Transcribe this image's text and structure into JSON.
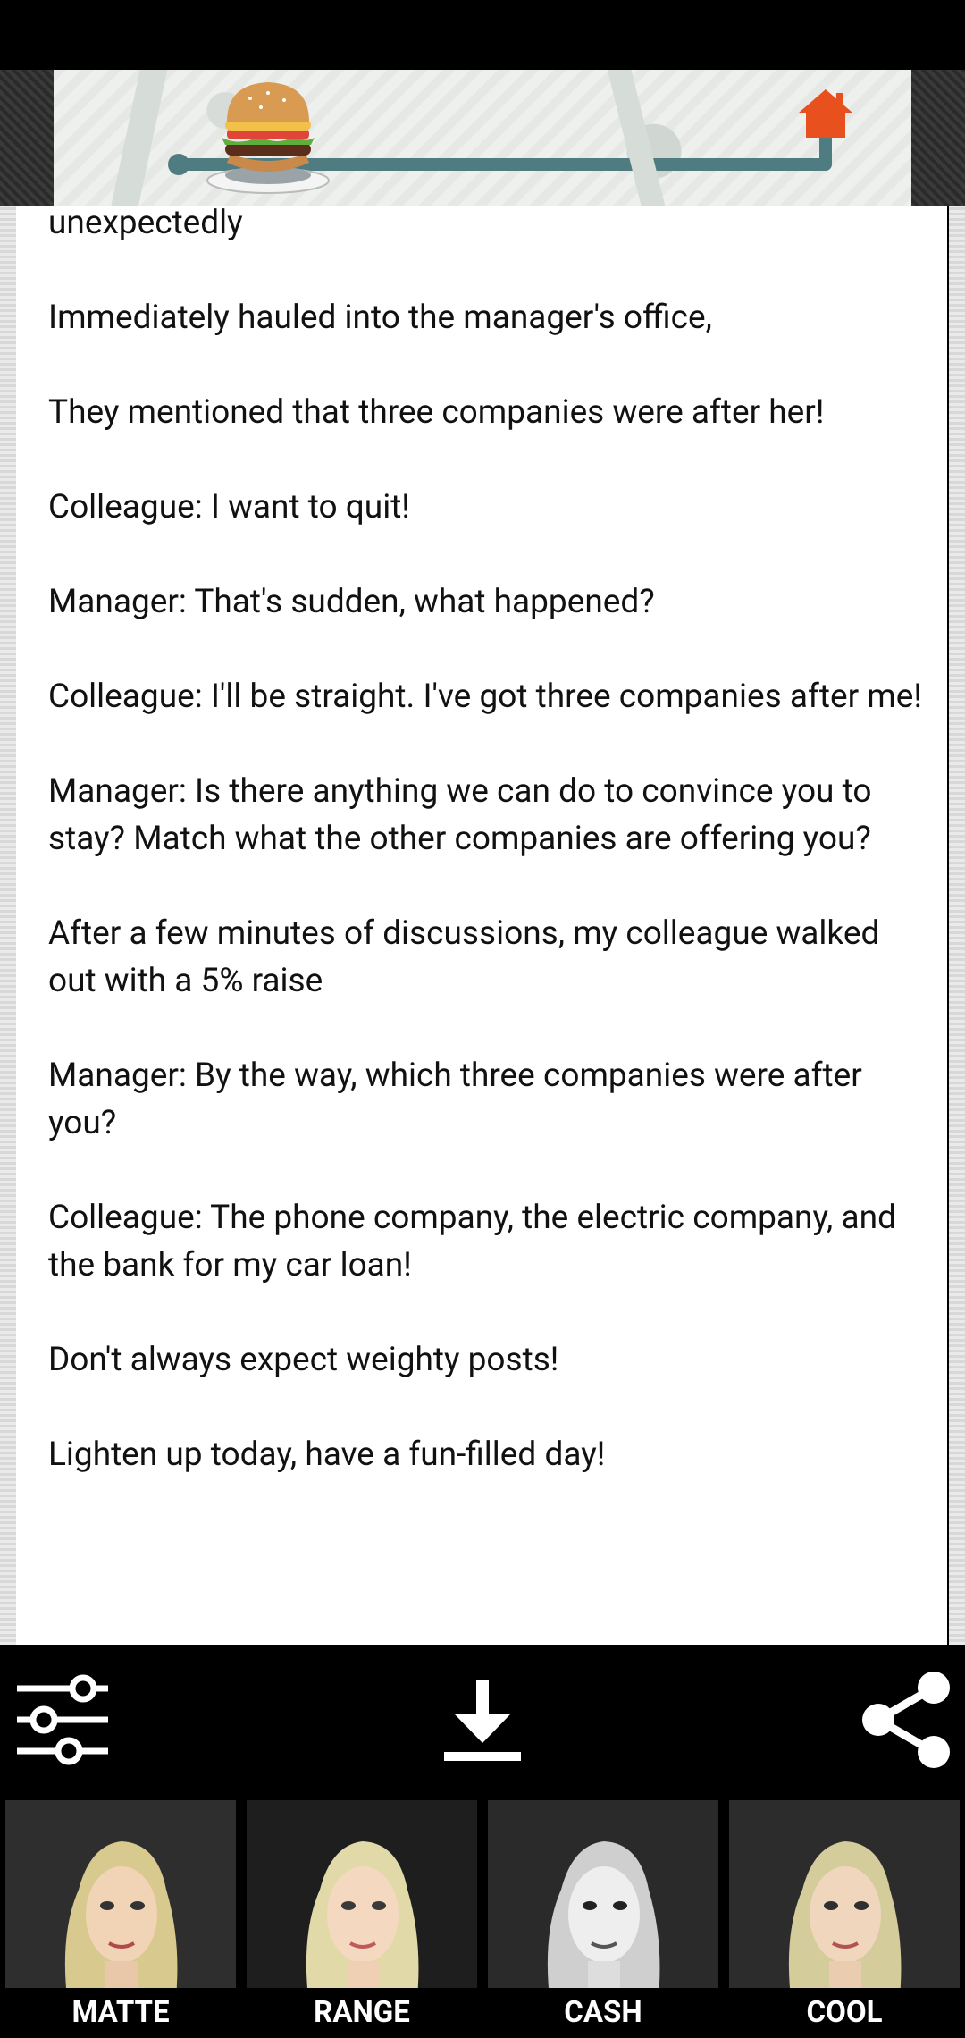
{
  "text": {
    "lines": [
      "unexpectedly",
      "Immediately hauled into the manager's office,",
      "They mentioned that three companies were after her!",
      "Colleague: I want to quit!",
      "Manager: That's sudden, what happened?",
      "Colleague: I'll be straight. I've got three companies after me!",
      "Manager: Is there anything we can do to convince you to stay? Match what the other companies are offering you?",
      "After a few minutes of discussions, my colleague walked out with a 5% raise",
      "Manager: By the way, which three companies were after you?",
      "Colleague: The phone company, the electric company, and the bank for my car loan!",
      "Don't always expect weighty posts!",
      "Lighten up today, have a fun-filled day!"
    ]
  },
  "toolbar": {
    "adjust_icon": "sliders-icon",
    "download_icon": "download-icon",
    "share_icon": "share-icon"
  },
  "filters": [
    {
      "label": "MATTE"
    },
    {
      "label": "RANGE"
    },
    {
      "label": "CASH"
    },
    {
      "label": "COOL"
    }
  ],
  "colors": {
    "route": "#4f7c80",
    "home": "#e8501e",
    "background": "#000000",
    "text": "#111111"
  }
}
